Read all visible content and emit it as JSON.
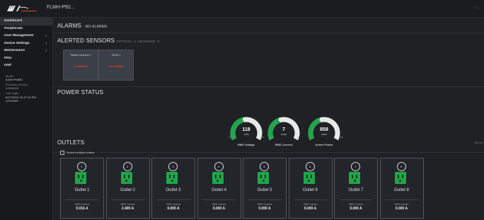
{
  "header": {
    "device_name": "FLMH-P92...",
    "user_menu": "⁝ ..."
  },
  "sidebar": {
    "items": [
      {
        "label": "Dashboard",
        "active": true,
        "has_chevron": false
      },
      {
        "label": "Peripherals",
        "active": false,
        "has_chevron": false
      },
      {
        "label": "User Management",
        "active": false,
        "has_chevron": true
      },
      {
        "label": "Device Settings",
        "active": false,
        "has_chevron": true
      },
      {
        "label": "Maintenance",
        "active": false,
        "has_chevron": true
      },
      {
        "label": "PDU",
        "active": false,
        "has_chevron": false
      },
      {
        "label": "Intel",
        "active": false,
        "has_chevron": false
      }
    ],
    "info": {
      "model_label": "Model",
      "model_value": "ILMH-P92MC",
      "firmware_label": "Firmware Version",
      "firmware_value": "1.0.14.0.0",
      "last_login_label": "Last Login",
      "last_login_value": "6/27/2024, 02:27:15 PM UTC/GMT"
    }
  },
  "alarms": {
    "title": "ALARMS",
    "status": ": NO ALARMS"
  },
  "alerted_sensors": {
    "title": "ALERTED SENSORS",
    "summary": "CRITICAL: 2 | WARNING: 0",
    "cards": [
      {
        "name": "Tamper Detector 1",
        "state": "ALARMED"
      },
      {
        "name": "OnOff 1",
        "state": "ALARMED"
      }
    ]
  },
  "power_status": {
    "title": "POWER STATUS",
    "gauges": [
      {
        "name": "RMS Voltage",
        "value": "118",
        "unit": "volts",
        "min": "0.00",
        "max": "130",
        "fraction": 0.45
      },
      {
        "name": "RMS Current",
        "value": "7",
        "unit": "amps",
        "min": "0",
        "max": "16",
        "fraction": 0.42
      },
      {
        "name": "Active Power",
        "value": "858",
        "unit": "watts",
        "min": "0",
        "max": "2000",
        "fraction": 0.43
      }
    ]
  },
  "outlets": {
    "title": "OUTLETS",
    "select_multiple_label": "Select multiple outlets",
    "header_actions": "Off  On",
    "current_label": "RMS Current",
    "items": [
      {
        "number": "1",
        "name": "Outlet 1",
        "current": "0.016 A"
      },
      {
        "number": "2",
        "name": "Outlet 2",
        "current": "2.405 A"
      },
      {
        "number": "3",
        "name": "Outlet 3",
        "current": "0.000 A"
      },
      {
        "number": "4",
        "name": "Outlet 4",
        "current": "0.000 A"
      },
      {
        "number": "5",
        "name": "Outlet 5",
        "current": "0.000 A"
      },
      {
        "number": "6",
        "name": "Outlet 6",
        "current": "0.000 A"
      },
      {
        "number": "7",
        "name": "Outlet 7",
        "current": "0.000 A"
      },
      {
        "number": "8",
        "name": "Outlet 8",
        "current": "0.000 A"
      }
    ]
  },
  "colors": {
    "gauge_fill": "#21a54a",
    "gauge_track": "#e8e8e8",
    "alarm_red": "#e03a2e",
    "outlet_on": "#21a54a"
  }
}
